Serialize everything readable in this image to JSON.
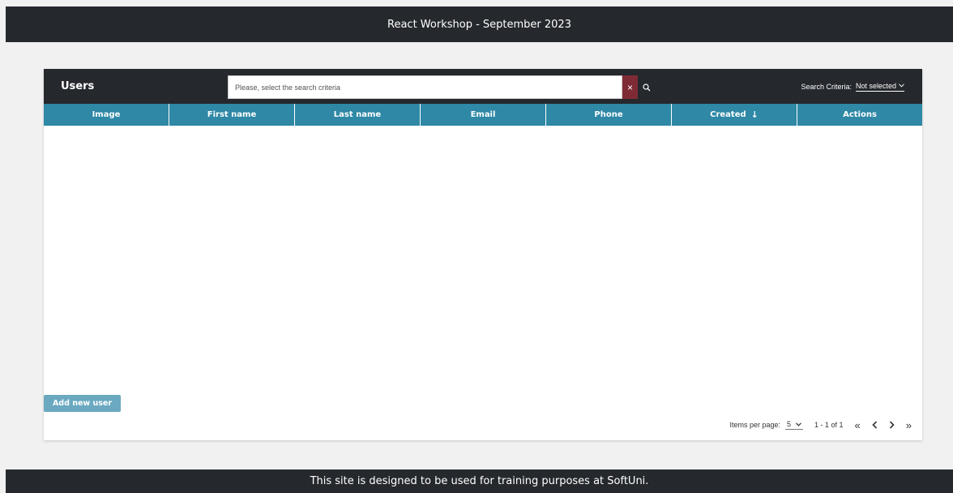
{
  "app": {
    "header_title": "React Workshop - September 2023",
    "footer_text": "This site is designed to be used for training purposes at SoftUni."
  },
  "users_card": {
    "title": "Users",
    "search": {
      "value": "",
      "placeholder": "Please, select the search criteria",
      "clear_label": "×"
    },
    "criteria": {
      "label": "Search Criteria:",
      "selected": "Not selected"
    },
    "columns": [
      "Image",
      "First name",
      "Last name",
      "Email",
      "Phone",
      "Created",
      "Actions"
    ],
    "sorted_column": "Created",
    "sort_indicator": "↓",
    "rows": [],
    "add_button_label": "Add new user",
    "pagination": {
      "items_per_page_label": "Items per page:",
      "items_per_page_value": "5",
      "range_label": "1 - 1 of 1",
      "first_icon": "«",
      "prev_icon": "chevron-left-icon",
      "next_icon": "chevron-right-icon",
      "last_icon": "»"
    }
  },
  "colors": {
    "header_bg": "#25282d",
    "table_header_bg": "#2e88a6",
    "clear_button_bg": "#7f2b35",
    "add_button_bg": "#6aa9c0",
    "page_bg": "#f1f1f1"
  }
}
